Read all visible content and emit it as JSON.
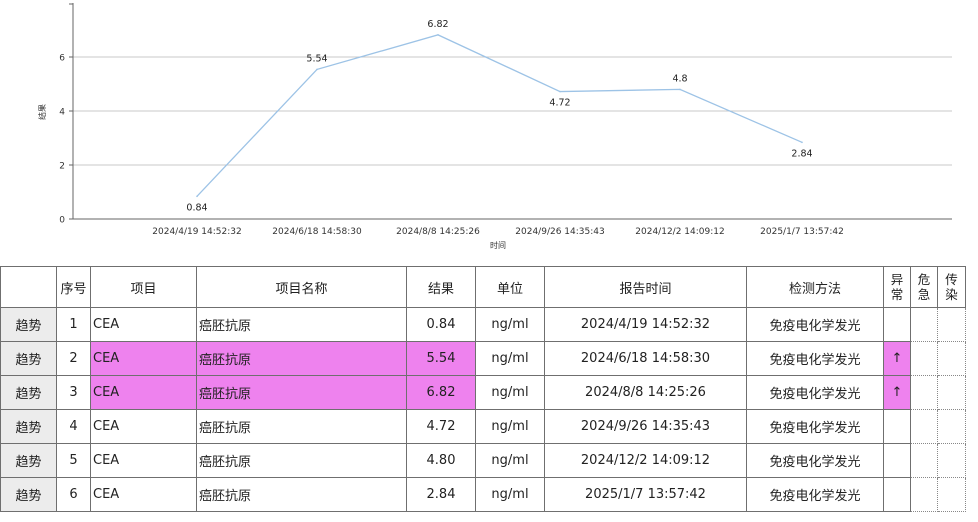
{
  "tabs": [
    "",
    ""
  ],
  "chart_data": {
    "type": "line",
    "x": [
      "2024/4/19 14:52:32",
      "2024/6/18 14:58:30",
      "2024/8/8 14:25:26",
      "2024/9/26 14:35:43",
      "2024/12/2 14:09:12",
      "2025/1/7 13:57:42"
    ],
    "series": [
      {
        "values": [
          0.84,
          5.54,
          6.82,
          4.72,
          4.8,
          2.84
        ],
        "labels": [
          "0.84",
          "5.54",
          "6.82",
          "4.72",
          "4.8",
          "2.84"
        ],
        "color": "#9dc3e6"
      }
    ],
    "xlabel": "时间",
    "ylabel": "结果",
    "yticks": [
      "0",
      "2",
      "4",
      "6"
    ],
    "ylim": [
      0,
      8
    ],
    "grid": true
  },
  "table": {
    "headers": {
      "trend": "",
      "seq": "序号",
      "item": "项目",
      "name": "项目名称",
      "result": "结果",
      "unit": "单位",
      "time": "报告时间",
      "method": "检测方法",
      "abnormal": [
        "异",
        "常"
      ],
      "critical": [
        "危",
        "急"
      ],
      "infectious": [
        "传",
        "染"
      ]
    },
    "rows": [
      {
        "trend": "趋势",
        "seq": "1",
        "item": "CEA",
        "name": "癌胚抗原",
        "result": "0.84",
        "unit": "ng/ml",
        "time": "2024/4/19 14:52:32",
        "method": "免疫电化学发光",
        "abnormal": "",
        "critical": "",
        "infectious": "",
        "highlight": false
      },
      {
        "trend": "趋势",
        "seq": "2",
        "item": "CEA",
        "name": "癌胚抗原",
        "result": "5.54",
        "unit": "ng/ml",
        "time": "2024/6/18 14:58:30",
        "method": "免疫电化学发光",
        "abnormal": "↑",
        "critical": "",
        "infectious": "",
        "highlight": true
      },
      {
        "trend": "趋势",
        "seq": "3",
        "item": "CEA",
        "name": "癌胚抗原",
        "result": "6.82",
        "unit": "ng/ml",
        "time": "2024/8/8 14:25:26",
        "method": "免疫电化学发光",
        "abnormal": "↑",
        "critical": "",
        "infectious": "",
        "highlight": true
      },
      {
        "trend": "趋势",
        "seq": "4",
        "item": "CEA",
        "name": "癌胚抗原",
        "result": "4.72",
        "unit": "ng/ml",
        "time": "2024/9/26 14:35:43",
        "method": "免疫电化学发光",
        "abnormal": "",
        "critical": "",
        "infectious": "",
        "highlight": false
      },
      {
        "trend": "趋势",
        "seq": "5",
        "item": "CEA",
        "name": "癌胚抗原",
        "result": "4.80",
        "unit": "ng/ml",
        "time": "2024/12/2 14:09:12",
        "method": "免疫电化学发光",
        "abnormal": "",
        "critical": "",
        "infectious": "",
        "highlight": false
      },
      {
        "trend": "趋势",
        "seq": "6",
        "item": "CEA",
        "name": "癌胚抗原",
        "result": "2.84",
        "unit": "ng/ml",
        "time": "2025/1/7 13:57:42",
        "method": "免疫电化学发光",
        "abnormal": "",
        "critical": "",
        "infectious": "",
        "highlight": false
      }
    ],
    "highlight_color": "#ee82ee"
  }
}
